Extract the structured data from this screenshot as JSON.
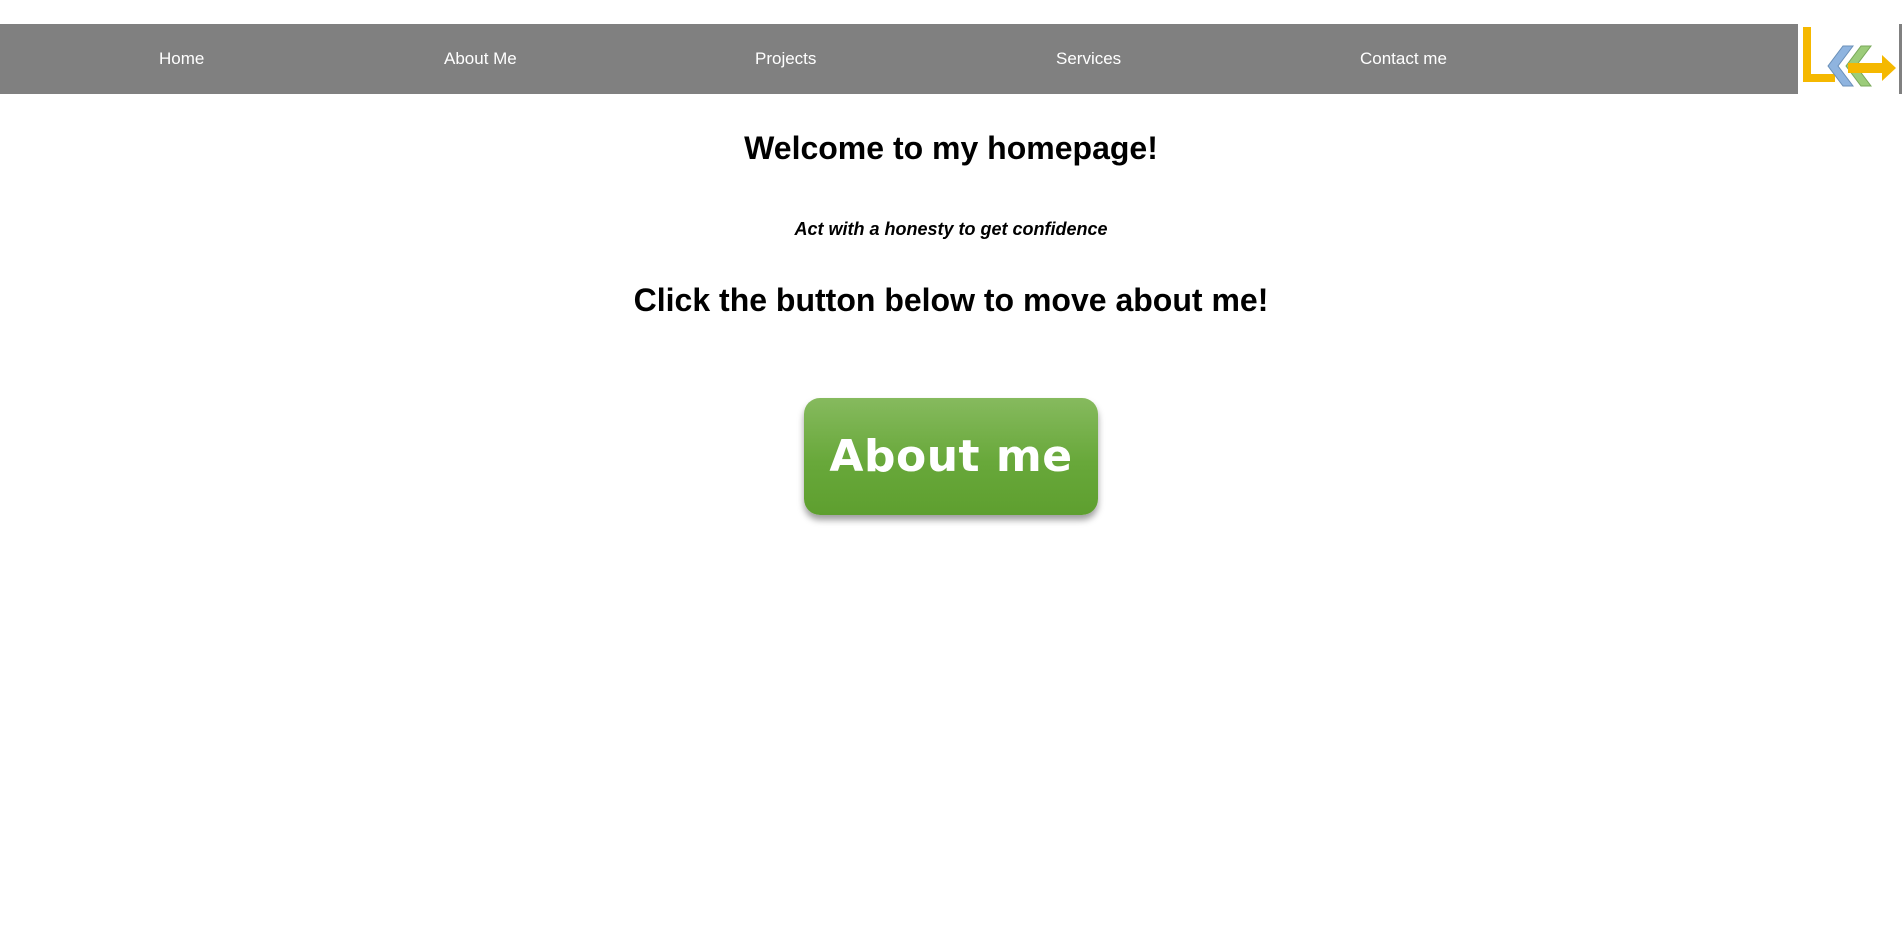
{
  "nav": {
    "items": [
      {
        "label": "Home"
      },
      {
        "label": "About Me"
      },
      {
        "label": "Projects"
      },
      {
        "label": "Services"
      },
      {
        "label": "Contact me"
      }
    ],
    "background_color": "#808080",
    "text_color": "#ffffff"
  },
  "logo": {
    "icon": "logo-icon",
    "colors": {
      "letter": "#f5b800",
      "chevron_blue": "#8fb4df",
      "chevron_green": "#9ccc7a",
      "arrow": "#f5b800"
    }
  },
  "main": {
    "welcome_heading": "Welcome to my homepage!",
    "quote": "Act with a honesty to get confidence",
    "cta_heading": "Click the button below to move about me!",
    "about_button_label": "About me",
    "button_color": "#6aa83c"
  }
}
